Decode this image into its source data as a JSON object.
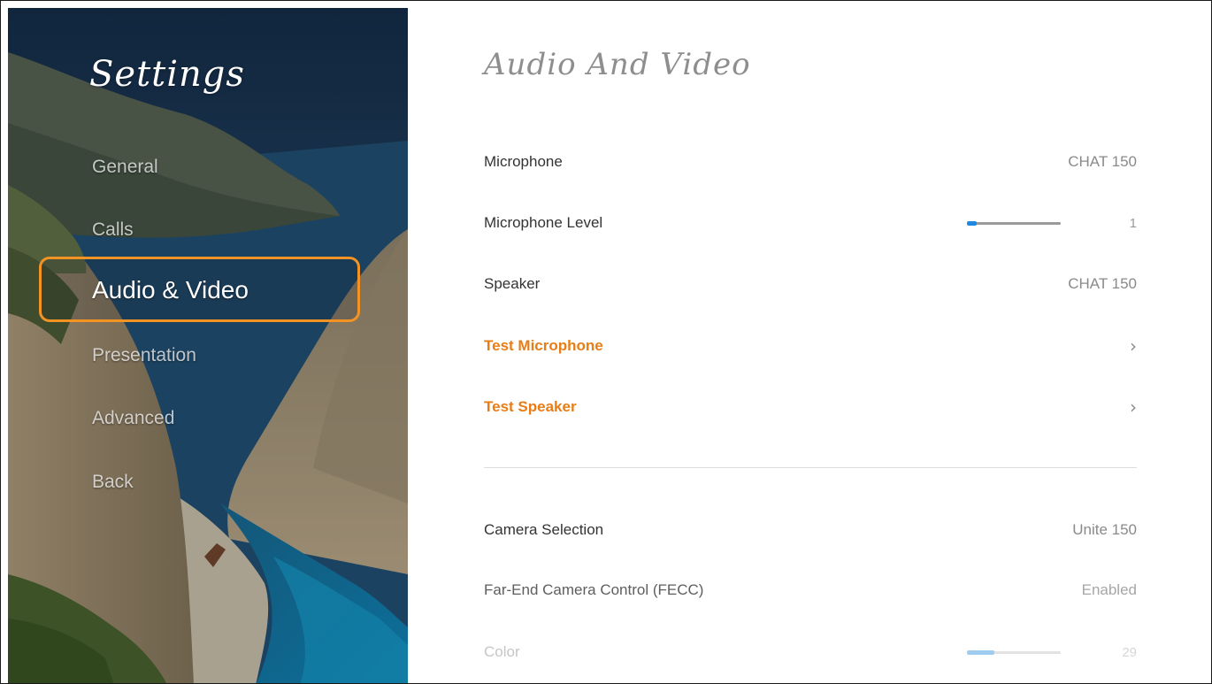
{
  "app": {
    "title": "Settings"
  },
  "sidebar": {
    "items": [
      {
        "label": "General"
      },
      {
        "label": "Calls"
      },
      {
        "label": "Audio & Video"
      },
      {
        "label": "Presentation"
      },
      {
        "label": "Advanced"
      },
      {
        "label": "Back"
      }
    ],
    "selected": "Audio & Video"
  },
  "main": {
    "title": "Audio And Video",
    "audio": {
      "microphone": {
        "label": "Microphone",
        "value": "CHAT 150"
      },
      "microphone_level": {
        "label": "Microphone Level",
        "value": "1",
        "level_fraction": 0.1
      },
      "speaker": {
        "label": "Speaker",
        "value": "CHAT 150"
      },
      "test_microphone": {
        "label": "Test Microphone",
        "icon": "chevron-right-icon"
      },
      "test_speaker": {
        "label": "Test Speaker",
        "icon": "chevron-right-icon"
      }
    },
    "video": {
      "camera_selection": {
        "label": "Camera Selection",
        "value": "Unite 150"
      },
      "fecc": {
        "label": "Far-End Camera Control (FECC)",
        "value": "Enabled"
      },
      "color": {
        "label": "Color",
        "value": "29",
        "level_fraction": 0.29
      }
    }
  },
  "colors": {
    "accent": "#e87d16",
    "focus_ring": "#f29324",
    "slider_fill": "#1e88e5"
  }
}
